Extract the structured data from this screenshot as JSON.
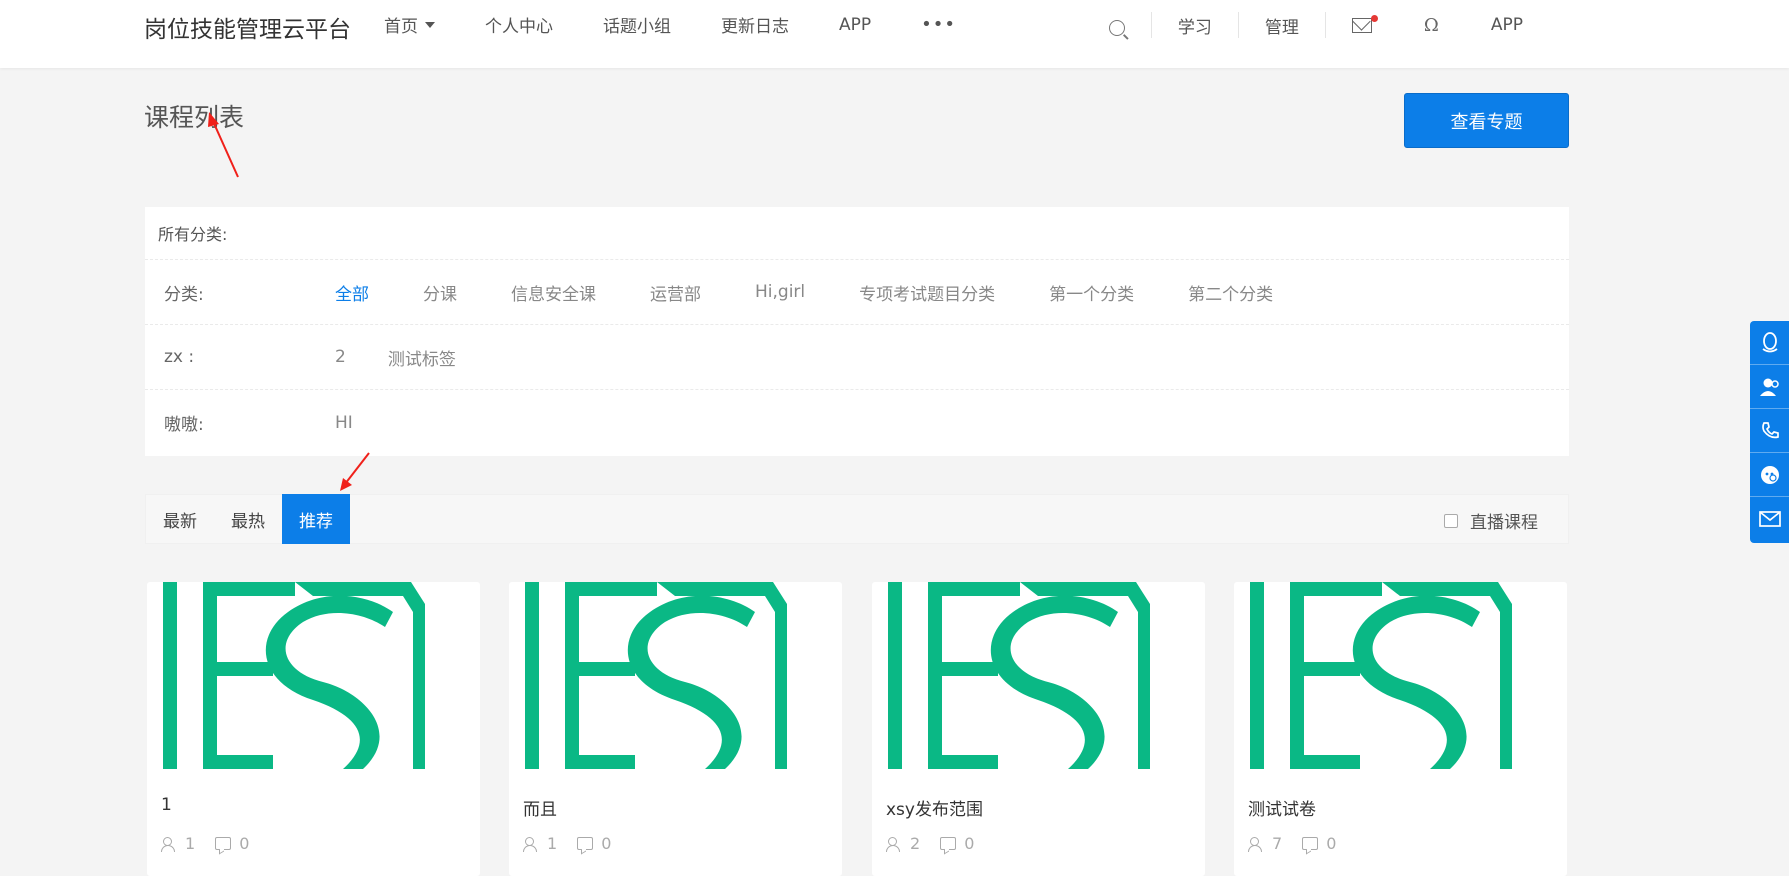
{
  "header": {
    "brand": "岗位技能管理云平台",
    "nav": [
      {
        "label": "首页",
        "has_caret": true
      },
      {
        "label": "个人中心"
      },
      {
        "label": "话题小组"
      },
      {
        "label": "更新日志"
      },
      {
        "label": "APP"
      }
    ],
    "more_label": "•••",
    "right": {
      "learn": "学习",
      "manage": "管理",
      "app": "APP"
    },
    "icons": [
      "search-icon",
      "mail-icon",
      "user-icon"
    ]
  },
  "page": {
    "title": "课程列表",
    "topic_button": "查看专题"
  },
  "filter": {
    "header": "所有分类:",
    "rows": [
      {
        "label": "分类:",
        "options": [
          "全部",
          "分课",
          "信息安全课",
          "运营部",
          "Hi,girl",
          "专项考试题目分类",
          "第一个分类",
          "第二个分类"
        ],
        "active": 0
      },
      {
        "label": "zx :",
        "options": [
          "2",
          "测试标签"
        ]
      },
      {
        "label": "嗷嗷:",
        "options": [
          "HI"
        ]
      }
    ]
  },
  "sort": {
    "tabs": [
      "最新",
      "最热",
      "推荐"
    ],
    "active": 2,
    "live_label": "直播课程"
  },
  "courses": [
    {
      "title": "1",
      "students": "1",
      "comments": "0"
    },
    {
      "title": "而且",
      "students": "1",
      "comments": "0"
    },
    {
      "title": "xsy发布范围",
      "students": "2",
      "comments": "0"
    },
    {
      "title": "测试试卷",
      "students": "7",
      "comments": "0"
    }
  ],
  "colors": {
    "primary": "#0c7ee8",
    "logo_green": "#0ab885",
    "annotation_red": "#f0201a"
  },
  "side_icons": [
    "qq-icon",
    "contact-icon",
    "phone-icon",
    "wechat-icon",
    "mail-icon"
  ]
}
